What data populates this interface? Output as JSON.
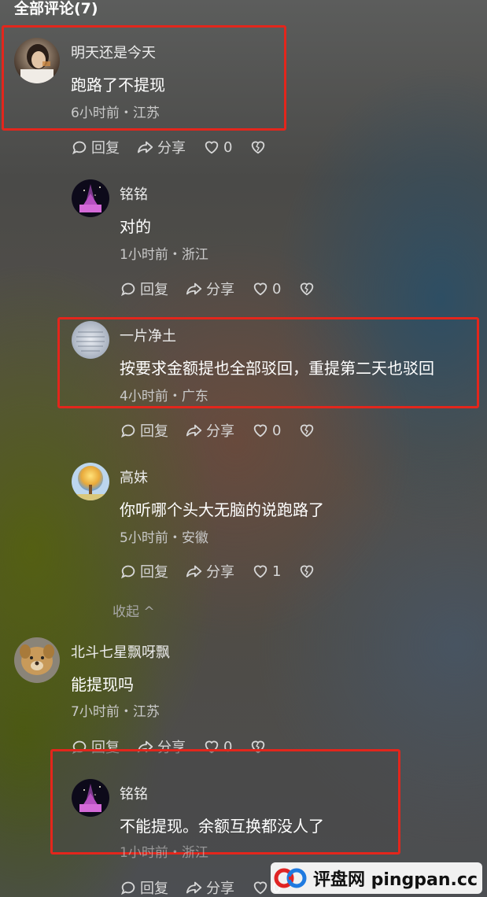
{
  "header": {
    "title": "全部评论(7)"
  },
  "labels": {
    "reply": "回复",
    "share": "分享"
  },
  "comments": [
    {
      "username": "明天还是今天",
      "text": "跑路了不提现",
      "meta": "6小时前・江苏",
      "likes": "0"
    },
    {
      "username": "铭铭",
      "text": "对的",
      "meta": "1小时前・浙江",
      "likes": "0"
    },
    {
      "username": "一片净土",
      "text": "按要求金额提也全部驳回，重提第二天也驳回",
      "meta": "4小时前・广东",
      "likes": "0"
    },
    {
      "username": "高妹",
      "text": "你听哪个头大无脑的说跑路了",
      "meta": "5小时前・安徽",
      "likes": "1"
    },
    {
      "username": "北斗七星飘呀飘",
      "text": "能提现吗",
      "meta": "7小时前・江苏",
      "likes": "0"
    },
    {
      "username": "铭铭",
      "text": "不能提现。余额互换都没人了",
      "meta": "1小时前・浙江",
      "likes": "0"
    }
  ],
  "collapse_label": "收起 ^",
  "watermark": {
    "text": "评盘网 pingpan.cc"
  },
  "colors": {
    "highlight_border": "#e3261c",
    "accent": "#ffffff"
  }
}
